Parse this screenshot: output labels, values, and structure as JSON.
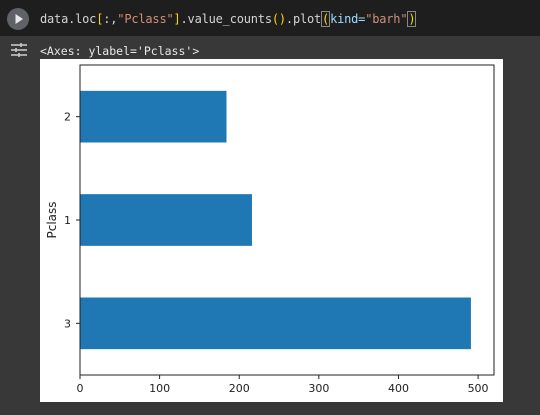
{
  "cell": {
    "code_tokens": {
      "t1": "data.loc",
      "t2": "[",
      "t3": ":,",
      "t4": "\"Pclass\"",
      "t5": "]",
      "t6": ".value_counts",
      "t7": "()",
      "t8": ".plot",
      "t9": "(",
      "t10": "kind=",
      "t11": "\"barh\"",
      "t12": ")"
    },
    "output_text": "<Axes: ylabel='Pclass'>"
  },
  "chart_data": {
    "type": "bar",
    "orientation": "horizontal",
    "categories": [
      "3",
      "1",
      "2"
    ],
    "values": [
      491,
      216,
      184
    ],
    "ylabel": "Pclass",
    "xlabel": "",
    "xlim": [
      0,
      520
    ],
    "xticks": [
      "0",
      "100",
      "200",
      "300",
      "400",
      "500"
    ],
    "grid": false,
    "bar_color": "#1f77b4"
  },
  "colors": {
    "cell_background": "#383838",
    "code_background": "#1e1e1e",
    "run_button": "#5f6368"
  }
}
